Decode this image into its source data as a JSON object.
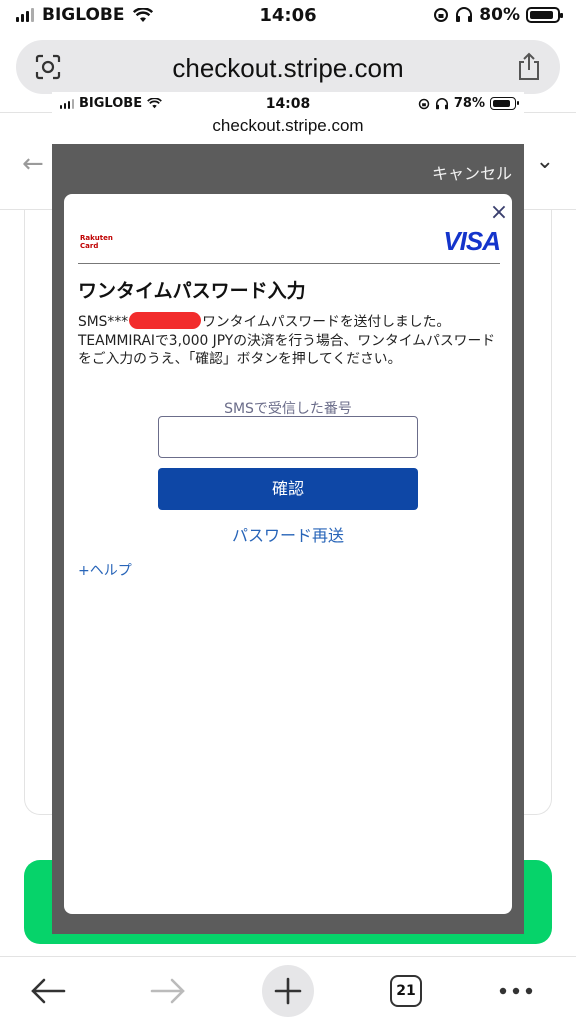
{
  "status_bar": {
    "carrier": "BIGLOBE",
    "time": "14:06",
    "battery": "80%",
    "battery_level": 0.8
  },
  "browser": {
    "url": "checkout.stripe.com"
  },
  "inner_screenshot": {
    "status_bar": {
      "carrier": "BIGLOBE",
      "time": "14:08",
      "battery": "78%",
      "battery_level": 0.78
    },
    "url": "checkout.stripe.com",
    "cancel_label": "キャンセル",
    "modal": {
      "close_symbol": "×",
      "issuer_logo_text": "Rakuten Card",
      "network_logo": "VISA",
      "title": "ワンタイムパスワード入力",
      "desc_prefix": "SMS***",
      "desc_rest": "ワンタイムパスワードを送付しました。TEAMMIRAIで3,000 JPYの決済を行う場合、ワンタイムパスワードをご入力のうえ、「確認」ボタンを押してください。",
      "field_label": "SMSで受信した番号",
      "field_value": "",
      "confirm_label": "確認",
      "resend_label": "パスワード再送",
      "help_label": "+ヘルプ"
    }
  },
  "toolbar": {
    "tab_count": "21"
  },
  "colors": {
    "accent_blue": "#0e47a6",
    "green_button": "#06d36a",
    "redaction": "#f22c2c",
    "visa_blue": "#1434cb"
  }
}
